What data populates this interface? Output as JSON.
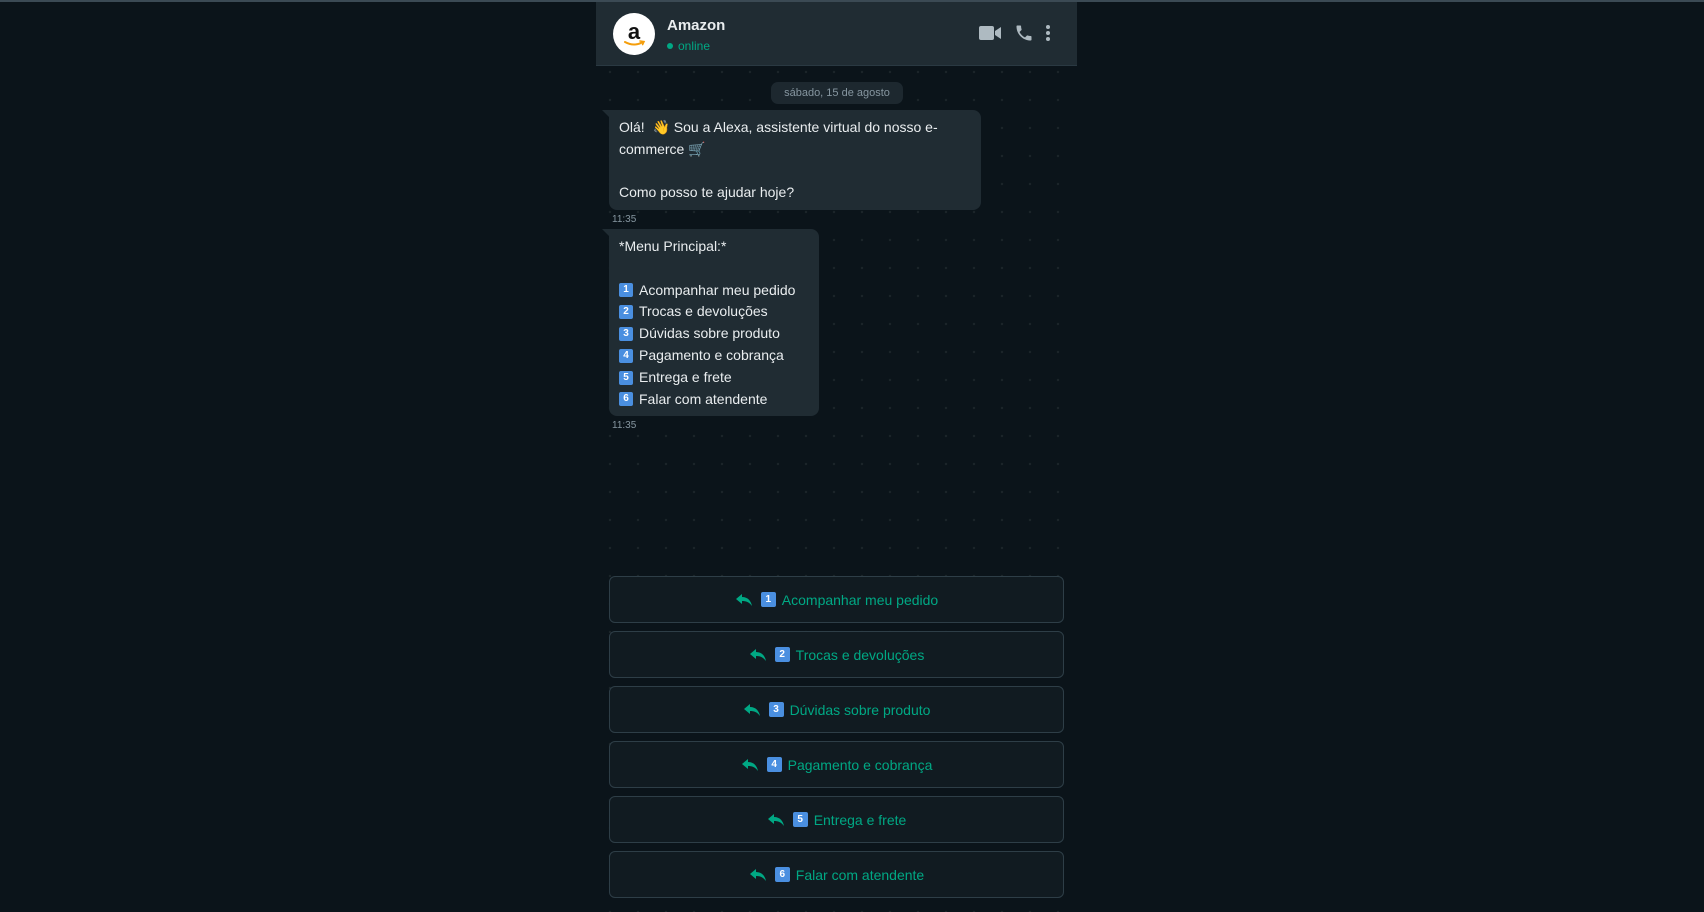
{
  "header": {
    "contact_name": "Amazon",
    "status": "online",
    "avatar_letter": "a",
    "icons": [
      "video-camera-icon",
      "phone-icon",
      "kebab-menu-icon"
    ]
  },
  "colors": {
    "accent": "#00a884",
    "bubble": "#202c33",
    "background": "#0b141a",
    "number_badge": "#4a8fe0"
  },
  "chat": {
    "date_separator": "sábado, 15 de agosto",
    "messages": [
      {
        "line1": "Olá!",
        "wave_emoji": "👋",
        "line1_rest": "Sou a Alexa, assistente virtual do nosso e-",
        "line2": "commerce",
        "cart_emoji": "🛒",
        "line3": "Como posso te ajudar hoje?",
        "time": "11:35"
      },
      {
        "title": "*Menu Principal:*",
        "items": [
          {
            "num": "1",
            "text": "Acompanhar meu pedido"
          },
          {
            "num": "2",
            "text": "Trocas e devoluções"
          },
          {
            "num": "3",
            "text": "Dúvidas sobre produto"
          },
          {
            "num": "4",
            "text": "Pagamento e cobrança"
          },
          {
            "num": "5",
            "text": "Entrega e frete"
          },
          {
            "num": "6",
            "text": "Falar com atendente"
          }
        ],
        "time": "11:35"
      }
    ]
  },
  "quick_replies": [
    {
      "num": "1",
      "label": "Acompanhar meu pedido"
    },
    {
      "num": "2",
      "label": "Trocas e devoluções"
    },
    {
      "num": "3",
      "label": "Dúvidas sobre produto"
    },
    {
      "num": "4",
      "label": "Pagamento e cobrança"
    },
    {
      "num": "5",
      "label": "Entrega e frete"
    },
    {
      "num": "6",
      "label": "Falar com atendente"
    }
  ]
}
